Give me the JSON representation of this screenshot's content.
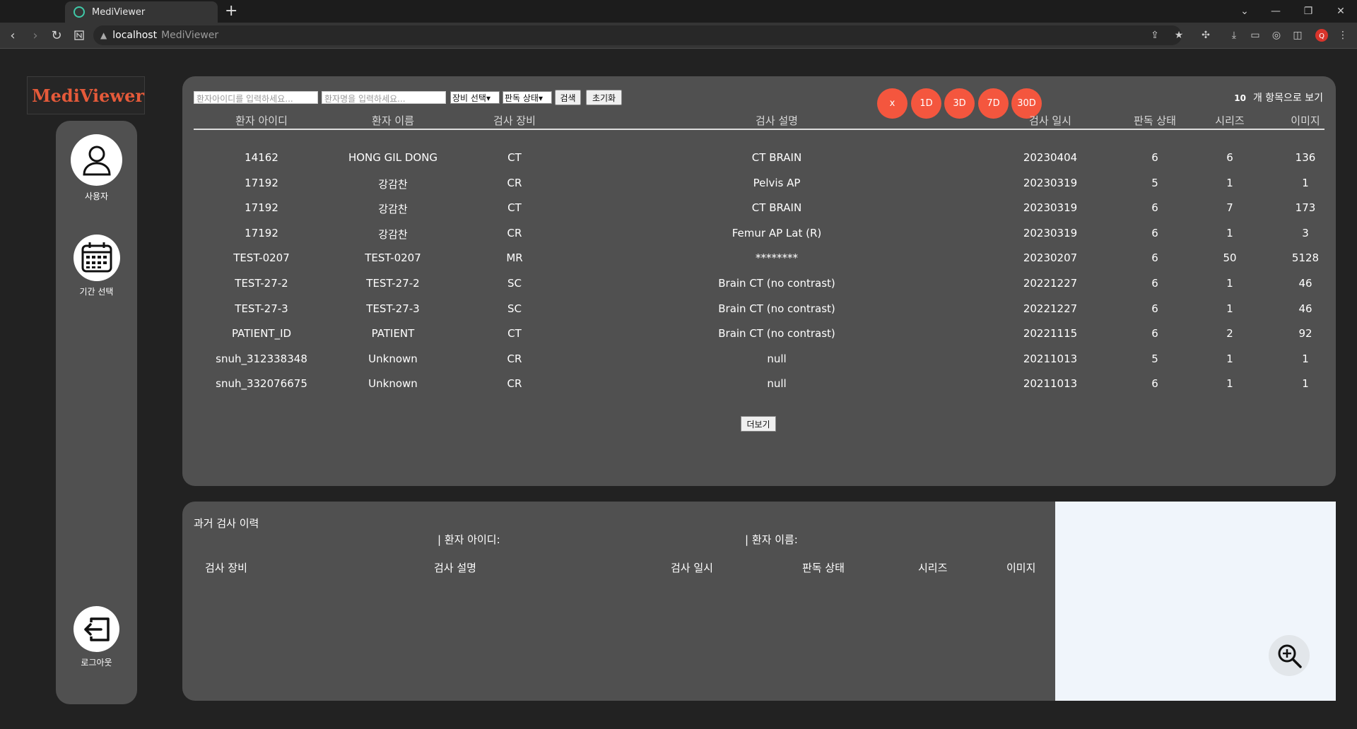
{
  "browser": {
    "tab_title": "MediViewer",
    "new_tab": "+",
    "url_host": "localhost",
    "url_title": "MediViewer"
  },
  "app": {
    "logo_text": "MediViewer",
    "sidebar": {
      "user_label": "사용자",
      "period_label": "기간 선택",
      "logout_label": "로그아웃"
    },
    "search": {
      "patient_id_placeholder": "환자아이디를 입력하세요...",
      "patient_name_placeholder": "환자명을 입력하세요...",
      "modality_select": "장비 선택",
      "status_select": "판독 상태",
      "search_button": "검색",
      "reset_button": "초기화"
    },
    "period_buttons": [
      "x",
      "1D",
      "3D",
      "7D",
      "30D"
    ],
    "per_page": {
      "count": "10",
      "label": "개 항목으로 보기"
    },
    "table": {
      "headers": [
        "환자 아이디",
        "환자 이름",
        "검사 장비",
        "검사 설명",
        "검사 일시",
        "판독 상태",
        "시리즈",
        "이미지"
      ],
      "rows": [
        [
          "14162",
          "HONG GIL DONG",
          "CT",
          "CT BRAIN",
          "20230404",
          "6",
          "6",
          "136"
        ],
        [
          "17192",
          "강감찬",
          "CR",
          "Pelvis AP",
          "20230319",
          "5",
          "1",
          "1"
        ],
        [
          "17192",
          "강감찬",
          "CT",
          "CT BRAIN",
          "20230319",
          "6",
          "7",
          "173"
        ],
        [
          "17192",
          "강감찬",
          "CR",
          "Femur AP Lat (R)",
          "20230319",
          "6",
          "1",
          "3"
        ],
        [
          "TEST-0207",
          "TEST-0207",
          "MR",
          "********",
          "20230207",
          "6",
          "50",
          "5128"
        ],
        [
          "TEST-27-2",
          "TEST-27-2",
          "SC",
          "Brain CT (no contrast)",
          "20221227",
          "6",
          "1",
          "46"
        ],
        [
          "TEST-27-3",
          "TEST-27-3",
          "SC",
          "Brain CT (no contrast)",
          "20221227",
          "6",
          "1",
          "46"
        ],
        [
          "PATIENT_ID",
          "PATIENT",
          "CT",
          "Brain CT (no contrast)",
          "20221115",
          "6",
          "2",
          "92"
        ],
        [
          "snuh_312338348",
          "Unknown",
          "CR",
          "null",
          "20211013",
          "5",
          "1",
          "1"
        ],
        [
          "snuh_332076675",
          "Unknown",
          "CR",
          "null",
          "20211013",
          "6",
          "1",
          "1"
        ]
      ],
      "more_button": "더보기"
    },
    "history": {
      "title": "과거 검사 이력",
      "patient_id_label": "| 환자 아이디:",
      "patient_name_label": "| 환자 이름:",
      "columns": [
        "검사 장비",
        "검사 설명",
        "검사 일시",
        "판독 상태",
        "시리즈",
        "이미지"
      ]
    }
  }
}
